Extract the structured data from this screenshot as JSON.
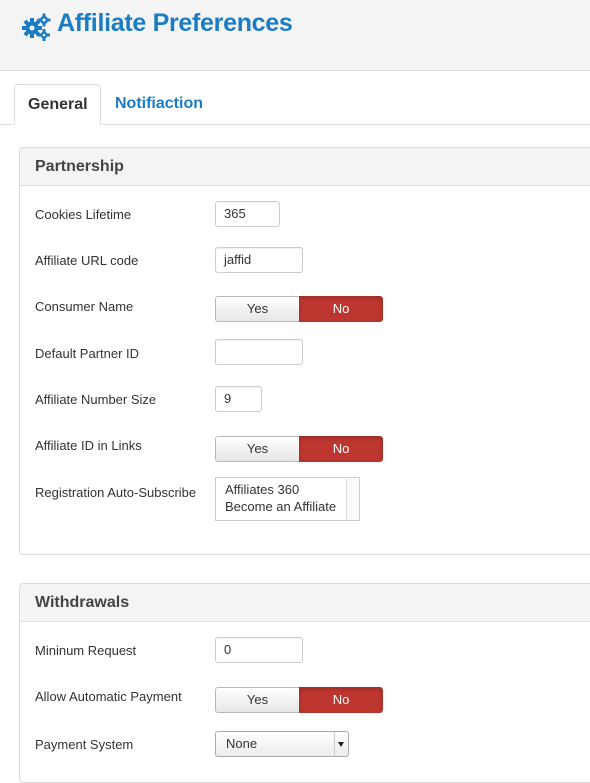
{
  "header": {
    "title": "Affiliate Preferences",
    "icon": "gears-icon",
    "accent_color": "#1a7dc4"
  },
  "tabs": [
    {
      "label": "General",
      "active": true
    },
    {
      "label": "Notifiaction",
      "active": false
    }
  ],
  "partnership": {
    "title": "Partnership",
    "cookies_lifetime": {
      "label": "Cookies Lifetime",
      "value": "365"
    },
    "affiliate_url_code": {
      "label": "Affiliate URL code",
      "value": "jaffid"
    },
    "consumer_name": {
      "label": "Consumer Name",
      "yes": "Yes",
      "no": "No",
      "selected": "No"
    },
    "default_partner_id": {
      "label": "Default Partner ID",
      "value": ""
    },
    "affiliate_number_size": {
      "label": "Affiliate Number Size",
      "value": "9"
    },
    "affiliate_id_in_links": {
      "label": "Affiliate ID in Links",
      "yes": "Yes",
      "no": "No",
      "selected": "No"
    },
    "registration_auto_subscribe": {
      "label": "Registration Auto-Subscribe",
      "options": [
        "Affiliates 360",
        "Become an Affiliate"
      ]
    }
  },
  "withdrawals": {
    "title": "Withdrawals",
    "minimum_request": {
      "label": "Mininum Request",
      "value": "0"
    },
    "allow_automatic_payment": {
      "label": "Allow Automatic Payment",
      "yes": "Yes",
      "no": "No",
      "selected": "No"
    },
    "payment_system": {
      "label": "Payment System",
      "value": "None"
    }
  },
  "colors": {
    "no_active": "#bd362f"
  }
}
